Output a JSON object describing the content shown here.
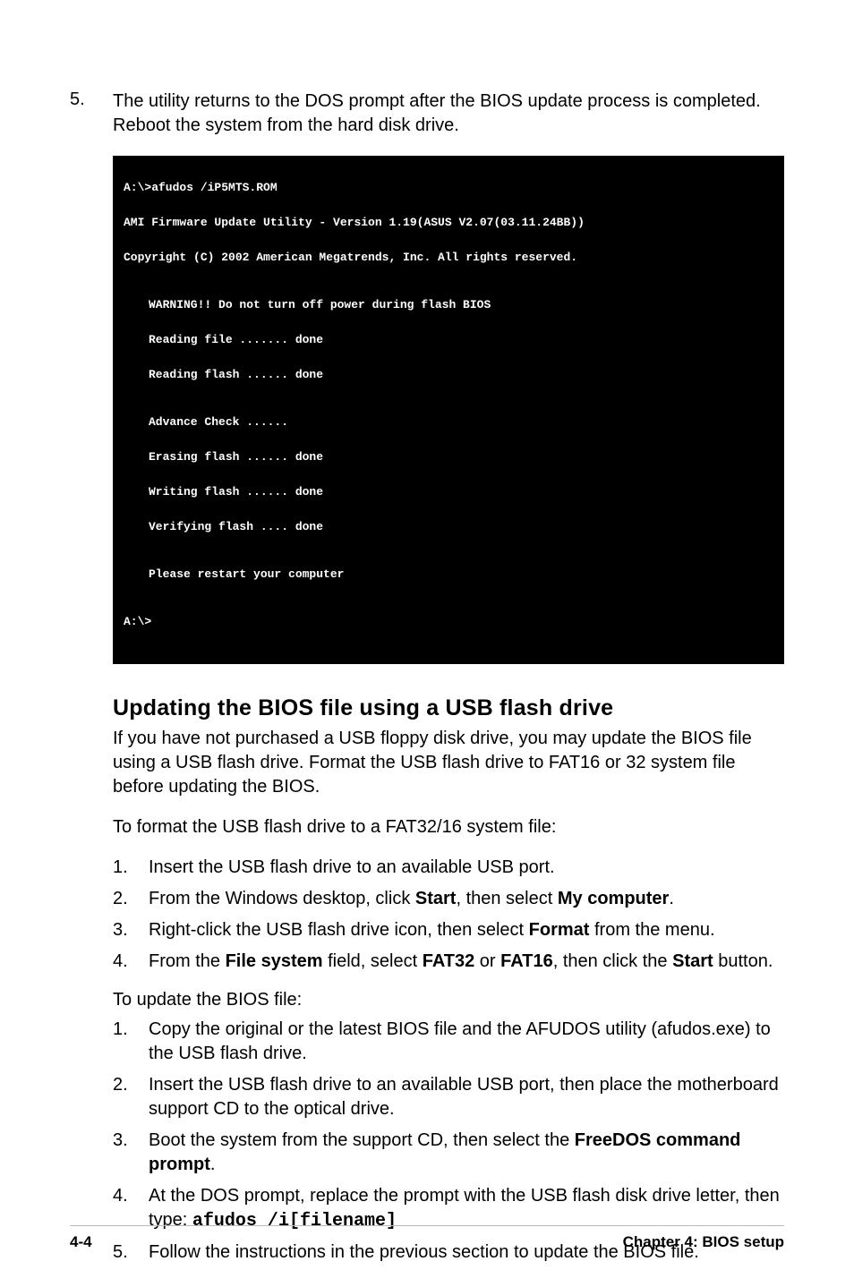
{
  "intro": {
    "num": "5.",
    "text": "The utility returns to the DOS prompt after the BIOS update process is completed. Reboot the system from the hard disk drive."
  },
  "terminal": {
    "l1": "A:\\>afudos /iP5MTS.ROM",
    "l2": "AMI Firmware Update Utility - Version 1.19(ASUS V2.07(03.11.24BB))",
    "l3": "Copyright (C) 2002 American Megatrends, Inc. All rights reserved.",
    "warn": "WARNING!! Do not turn off power during flash BIOS",
    "rf": "Reading file ....... done",
    "rfl": "Reading flash ...... done",
    "ac": "Advance Check ......",
    "ef": "Erasing flash ...... done",
    "wf": "Writing flash ...... done",
    "vf": "Verifying flash .... done",
    "restart": "Please restart your computer",
    "prompt": "A:\\>"
  },
  "section_title": "Updating the BIOS file using a USB flash drive",
  "p1_a": "If you have not purchased a USB floppy disk drive, you may update the BIOS file using a USB flash drive. Format the USB flash drive to FAT16 or 32 system file before updating the BIOS.",
  "p2": "To format the USB flash drive to a FAT32/16 system file:",
  "list1": {
    "i1": {
      "n": "1.",
      "t": "Insert the USB flash drive to an available USB port."
    },
    "i2": {
      "n": "2.",
      "a": "From the Windows desktop, click ",
      "b": "Start",
      "c": ", then select ",
      "d": "My computer",
      "e": "."
    },
    "i3": {
      "n": "3.",
      "a": "Right-click the USB flash drive icon, then select ",
      "b": "Format",
      "c": " from the menu."
    },
    "i4": {
      "n": "4.",
      "a": "From the ",
      "b": "File system",
      "c": " field, select ",
      "d": "FAT32",
      "e": " or ",
      "f": "FAT16",
      "g": ", then click the ",
      "h": "Start",
      "i": " button."
    }
  },
  "p3": "To update the BIOS file:",
  "list2": {
    "i1": {
      "n": "1.",
      "t": "Copy the original or the latest BIOS file and the AFUDOS utility (afudos.exe) to the USB flash drive."
    },
    "i2": {
      "n": "2.",
      "t": "Insert the USB flash drive to an available USB port, then place the motherboard support CD to the optical drive."
    },
    "i3": {
      "n": "3.",
      "a": "Boot the system from the support CD, then select the ",
      "b": "FreeDOS command prompt",
      "c": "."
    },
    "i4": {
      "n": "4.",
      "a": "At the DOS prompt, replace the prompt with the USB flash disk drive letter, then type: ",
      "cmd": "afudos /i[filename]"
    },
    "i5": {
      "n": "5.",
      "t": "Follow the instructions in the previous section to update the BIOS file."
    }
  },
  "footer": {
    "left": "4-4",
    "right": "Chapter 4: BIOS setup"
  }
}
